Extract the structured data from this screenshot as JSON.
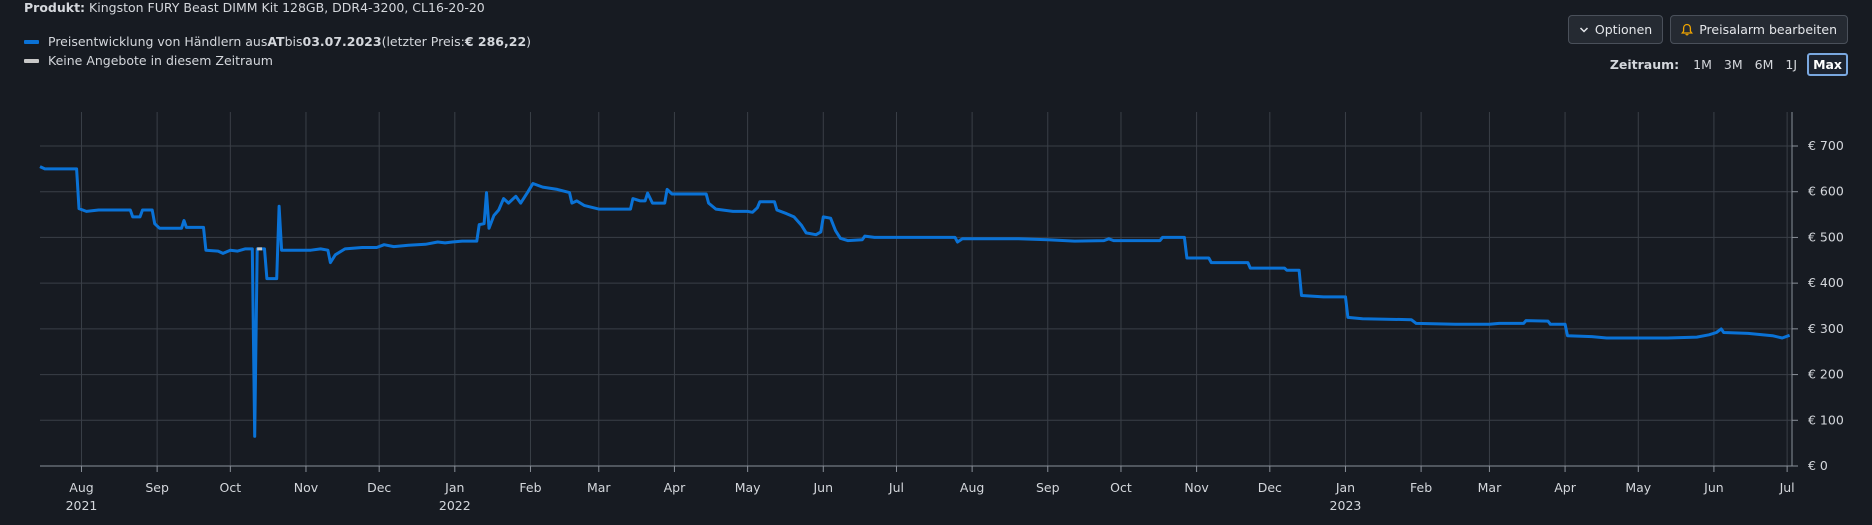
{
  "header": {
    "product_label": "Produkt:",
    "product_name": "Kingston FURY Beast DIMM Kit 128GB, DDR4-3200, CL16-20-20"
  },
  "legend": {
    "series_text_1": "Preisentwicklung von Händlern aus ",
    "series_country": "AT",
    "series_text_2": " bis ",
    "series_date": "03.07.2023",
    "series_text_3": " (letzter Preis: ",
    "series_last_price": "€ 286,22",
    "series_text_4": ")",
    "no_offers": "Keine Angebote in diesem Zeitraum"
  },
  "controls": {
    "options_label": "Optionen",
    "alarm_label": "Preisalarm bearbeiten"
  },
  "range": {
    "label": "Zeitraum:",
    "options": [
      "1M",
      "3M",
      "6M",
      "1J",
      "Max"
    ],
    "active": "Max"
  },
  "colors": {
    "line": "#0a72d6",
    "no_offers": "#c8c8c8",
    "grid": "#3a3f47",
    "alarm_bell": "#f0a500"
  },
  "chart_data": {
    "type": "line",
    "title": "",
    "xlabel": "",
    "ylabel": "",
    "x_range": [
      "2021-07-15",
      "2023-07-03"
    ],
    "ylim": [
      0,
      700
    ],
    "y_ticks": [
      0,
      100,
      200,
      300,
      400,
      500,
      600,
      700
    ],
    "y_tick_labels": [
      "€ 0",
      "€ 100",
      "€ 200",
      "€ 300",
      "€ 400",
      "€ 500",
      "€ 600",
      "€ 700"
    ],
    "y_tick_side": "right",
    "x_ticks": [
      {
        "date": "2021-08-01",
        "label": "Aug",
        "year": "2021"
      },
      {
        "date": "2021-09-01",
        "label": "Sep",
        "year": ""
      },
      {
        "date": "2021-10-01",
        "label": "Oct",
        "year": ""
      },
      {
        "date": "2021-11-01",
        "label": "Nov",
        "year": ""
      },
      {
        "date": "2021-12-01",
        "label": "Dec",
        "year": ""
      },
      {
        "date": "2022-01-01",
        "label": "Jan",
        "year": "2022"
      },
      {
        "date": "2022-02-01",
        "label": "Feb",
        "year": ""
      },
      {
        "date": "2022-03-01",
        "label": "Mar",
        "year": ""
      },
      {
        "date": "2022-04-01",
        "label": "Apr",
        "year": ""
      },
      {
        "date": "2022-05-01",
        "label": "May",
        "year": ""
      },
      {
        "date": "2022-06-01",
        "label": "Jun",
        "year": ""
      },
      {
        "date": "2022-07-01",
        "label": "Jul",
        "year": ""
      },
      {
        "date": "2022-08-01",
        "label": "Aug",
        "year": ""
      },
      {
        "date": "2022-09-01",
        "label": "Sep",
        "year": ""
      },
      {
        "date": "2022-10-01",
        "label": "Oct",
        "year": ""
      },
      {
        "date": "2022-11-01",
        "label": "Nov",
        "year": ""
      },
      {
        "date": "2022-12-01",
        "label": "Dec",
        "year": ""
      },
      {
        "date": "2023-01-01",
        "label": "Jan",
        "year": "2023"
      },
      {
        "date": "2023-02-01",
        "label": "Feb",
        "year": ""
      },
      {
        "date": "2023-03-01",
        "label": "Mar",
        "year": ""
      },
      {
        "date": "2023-04-01",
        "label": "Apr",
        "year": ""
      },
      {
        "date": "2023-05-01",
        "label": "May",
        "year": ""
      },
      {
        "date": "2023-06-01",
        "label": "Jun",
        "year": ""
      },
      {
        "date": "2023-07-01",
        "label": "Jul",
        "year": ""
      }
    ],
    "grid": true,
    "legend_position": "top-left",
    "no_offers_gaps": [
      [
        "2021-10-12",
        "2021-10-14"
      ]
    ],
    "series": [
      {
        "name": "Preisentwicklung von Händlern aus AT",
        "points": [
          [
            "2021-07-15",
            655
          ],
          [
            "2021-07-17",
            650
          ],
          [
            "2021-07-30",
            650
          ],
          [
            "2021-07-31",
            563
          ],
          [
            "2021-08-03",
            557
          ],
          [
            "2021-08-08",
            560
          ],
          [
            "2021-08-21",
            560
          ],
          [
            "2021-08-22",
            545
          ],
          [
            "2021-08-25",
            545
          ],
          [
            "2021-08-26",
            560
          ],
          [
            "2021-08-30",
            560
          ],
          [
            "2021-08-31",
            530
          ],
          [
            "2021-09-02",
            520
          ],
          [
            "2021-09-11",
            520
          ],
          [
            "2021-09-12",
            537
          ],
          [
            "2021-09-13",
            522
          ],
          [
            "2021-09-20",
            522
          ],
          [
            "2021-09-21",
            472
          ],
          [
            "2021-09-26",
            470
          ],
          [
            "2021-09-28",
            465
          ],
          [
            "2021-10-01",
            472
          ],
          [
            "2021-10-04",
            470
          ],
          [
            "2021-10-07",
            475
          ],
          [
            "2021-10-10",
            475
          ],
          [
            "2021-10-11",
            65
          ],
          [
            "2021-10-12",
            475
          ],
          [
            "2021-10-15",
            475
          ],
          [
            "2021-10-16",
            410
          ],
          [
            "2021-10-20",
            410
          ],
          [
            "2021-10-21",
            568
          ],
          [
            "2021-10-22",
            472
          ],
          [
            "2021-10-27",
            472
          ],
          [
            "2021-11-03",
            472
          ],
          [
            "2021-11-07",
            475
          ],
          [
            "2021-11-10",
            472
          ],
          [
            "2021-11-11",
            445
          ],
          [
            "2021-11-13",
            462
          ],
          [
            "2021-11-17",
            475
          ],
          [
            "2021-11-24",
            478
          ],
          [
            "2021-11-30",
            478
          ],
          [
            "2021-12-03",
            484
          ],
          [
            "2021-12-07",
            480
          ],
          [
            "2021-12-13",
            483
          ],
          [
            "2021-12-20",
            485
          ],
          [
            "2021-12-25",
            490
          ],
          [
            "2021-12-28",
            488
          ],
          [
            "2021-12-31",
            490
          ],
          [
            "2022-01-04",
            492
          ],
          [
            "2022-01-10",
            492
          ],
          [
            "2022-01-11",
            528
          ],
          [
            "2022-01-13",
            530
          ],
          [
            "2022-01-14",
            598
          ],
          [
            "2022-01-15",
            520
          ],
          [
            "2022-01-17",
            548
          ],
          [
            "2022-01-19",
            560
          ],
          [
            "2022-01-21",
            585
          ],
          [
            "2022-01-23",
            575
          ],
          [
            "2022-01-26",
            590
          ],
          [
            "2022-01-28",
            575
          ],
          [
            "2022-01-31",
            600
          ],
          [
            "2022-02-02",
            618
          ],
          [
            "2022-02-06",
            610
          ],
          [
            "2022-02-12",
            605
          ],
          [
            "2022-02-17",
            598
          ],
          [
            "2022-02-18",
            575
          ],
          [
            "2022-02-20",
            580
          ],
          [
            "2022-02-23",
            570
          ],
          [
            "2022-03-01",
            562
          ],
          [
            "2022-03-11",
            562
          ],
          [
            "2022-03-14",
            562
          ],
          [
            "2022-03-15",
            585
          ],
          [
            "2022-03-18",
            580
          ],
          [
            "2022-03-20",
            580
          ],
          [
            "2022-03-21",
            597
          ],
          [
            "2022-03-23",
            575
          ],
          [
            "2022-03-28",
            575
          ],
          [
            "2022-03-29",
            605
          ],
          [
            "2022-03-31",
            595
          ],
          [
            "2022-04-14",
            595
          ],
          [
            "2022-04-15",
            575
          ],
          [
            "2022-04-18",
            562
          ],
          [
            "2022-04-25",
            557
          ],
          [
            "2022-05-01",
            557
          ],
          [
            "2022-05-03",
            555
          ],
          [
            "2022-05-05",
            565
          ],
          [
            "2022-05-06",
            578
          ],
          [
            "2022-05-12",
            578
          ],
          [
            "2022-05-13",
            560
          ],
          [
            "2022-05-17",
            552
          ],
          [
            "2022-05-20",
            545
          ],
          [
            "2022-05-23",
            527
          ],
          [
            "2022-05-25",
            510
          ],
          [
            "2022-05-29",
            506
          ],
          [
            "2022-05-31",
            512
          ],
          [
            "2022-06-01",
            545
          ],
          [
            "2022-06-04",
            542
          ],
          [
            "2022-06-06",
            515
          ],
          [
            "2022-06-08",
            498
          ],
          [
            "2022-06-11",
            493
          ],
          [
            "2022-06-17",
            495
          ],
          [
            "2022-06-18",
            503
          ],
          [
            "2022-06-22",
            500
          ],
          [
            "2022-07-02",
            500
          ],
          [
            "2022-07-25",
            500
          ],
          [
            "2022-07-26",
            490
          ],
          [
            "2022-07-28",
            497
          ],
          [
            "2022-08-15",
            497
          ],
          [
            "2022-08-20",
            497
          ],
          [
            "2022-09-01",
            495
          ],
          [
            "2022-09-12",
            492
          ],
          [
            "2022-09-24",
            493
          ],
          [
            "2022-09-26",
            497
          ],
          [
            "2022-09-28",
            493
          ],
          [
            "2022-10-10",
            493
          ],
          [
            "2022-10-17",
            493
          ],
          [
            "2022-10-18",
            500
          ],
          [
            "2022-10-27",
            500
          ],
          [
            "2022-10-28",
            455
          ],
          [
            "2022-11-06",
            455
          ],
          [
            "2022-11-07",
            445
          ],
          [
            "2022-11-22",
            445
          ],
          [
            "2022-11-23",
            433
          ],
          [
            "2022-12-07",
            433
          ],
          [
            "2022-12-08",
            428
          ],
          [
            "2022-12-13",
            428
          ],
          [
            "2022-12-14",
            373
          ],
          [
            "2022-12-23",
            370
          ],
          [
            "2023-01-01",
            370
          ],
          [
            "2023-01-02",
            325
          ],
          [
            "2023-01-08",
            322
          ],
          [
            "2023-01-28",
            320
          ],
          [
            "2023-01-30",
            312
          ],
          [
            "2023-02-15",
            310
          ],
          [
            "2023-03-01",
            310
          ],
          [
            "2023-03-05",
            312
          ],
          [
            "2023-03-15",
            312
          ],
          [
            "2023-03-16",
            318
          ],
          [
            "2023-03-25",
            317
          ],
          [
            "2023-03-26",
            310
          ],
          [
            "2023-04-01",
            310
          ],
          [
            "2023-04-02",
            285
          ],
          [
            "2023-04-12",
            283
          ],
          [
            "2023-04-18",
            280
          ],
          [
            "2023-05-13",
            280
          ],
          [
            "2023-05-25",
            282
          ],
          [
            "2023-05-30",
            287
          ],
          [
            "2023-06-02",
            292
          ],
          [
            "2023-06-04",
            300
          ],
          [
            "2023-06-05",
            292
          ],
          [
            "2023-06-15",
            290
          ],
          [
            "2023-06-25",
            285
          ],
          [
            "2023-06-29",
            280
          ],
          [
            "2023-07-02",
            286
          ]
        ]
      }
    ]
  }
}
